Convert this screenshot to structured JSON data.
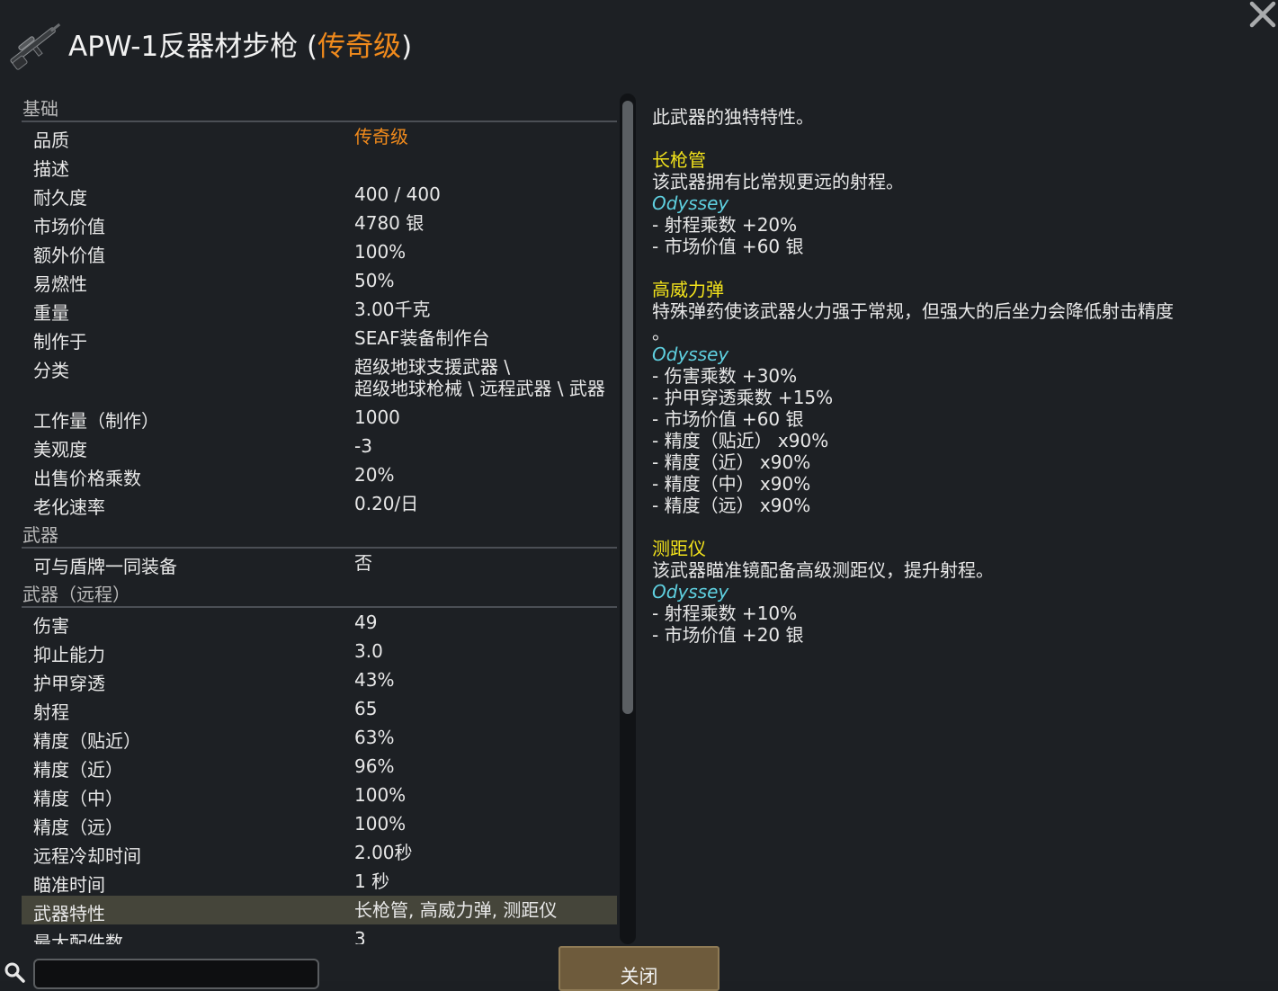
{
  "header": {
    "title_main": "APW-1反器材步枪 (",
    "title_quality": "传奇级",
    "title_close": ")",
    "weapon_icon": "sniper-rifle-icon",
    "close_icon": "close-x-icon"
  },
  "stats": [
    {
      "type": "cat",
      "label": "基础"
    },
    {
      "type": "row",
      "label": "品质",
      "value": "传奇级",
      "orange": true
    },
    {
      "type": "row",
      "label": "描述",
      "value": ""
    },
    {
      "type": "row",
      "label": "耐久度",
      "value": "400 / 400"
    },
    {
      "type": "row",
      "label": "市场价值",
      "value": "4780 银"
    },
    {
      "type": "row",
      "label": "额外价值",
      "value": "100%"
    },
    {
      "type": "row",
      "label": "易燃性",
      "value": "50%"
    },
    {
      "type": "row",
      "label": "重量",
      "value": "3.00千克"
    },
    {
      "type": "row",
      "label": "制作于",
      "value": "SEAF装备制作台"
    },
    {
      "type": "row",
      "label": "分类",
      "value": "超级地球支援武器 \\",
      "value2": "超级地球枪械 \\ 远程武器 \\ 武器"
    },
    {
      "type": "row",
      "label": "工作量（制作）",
      "value": "1000"
    },
    {
      "type": "row",
      "label": "美观度",
      "value": "-3"
    },
    {
      "type": "row",
      "label": "出售价格乘数",
      "value": "20%"
    },
    {
      "type": "row",
      "label": "老化速率",
      "value": "0.20/日"
    },
    {
      "type": "cat",
      "label": "武器"
    },
    {
      "type": "row",
      "label": "可与盾牌一同装备",
      "value": "否"
    },
    {
      "type": "cat",
      "label": "武器（远程）"
    },
    {
      "type": "row",
      "label": "伤害",
      "value": "49"
    },
    {
      "type": "row",
      "label": "抑止能力",
      "value": "3.0"
    },
    {
      "type": "row",
      "label": "护甲穿透",
      "value": "43%"
    },
    {
      "type": "row",
      "label": "射程",
      "value": "65"
    },
    {
      "type": "row",
      "label": "精度（贴近）",
      "value": "63%"
    },
    {
      "type": "row",
      "label": "精度（近）",
      "value": "96%"
    },
    {
      "type": "row",
      "label": "精度（中）",
      "value": "100%"
    },
    {
      "type": "row",
      "label": "精度（远）",
      "value": "100%"
    },
    {
      "type": "row",
      "label": "远程冷却时间",
      "value": "2.00秒"
    },
    {
      "type": "row",
      "label": "瞄准时间",
      "value": "1 秒"
    },
    {
      "type": "row",
      "label": "武器特性",
      "value": "长枪管, 高威力弹, 测距仪",
      "highlight": true
    },
    {
      "type": "row",
      "label": "最大配件数",
      "value": "3"
    }
  ],
  "description": {
    "intro": "此武器的独特特性。",
    "traits": [
      {
        "name": "长枪管",
        "desc": [
          "该武器拥有比常规更远的射程。"
        ],
        "source": "Odyssey",
        "mods": [
          "- 射程乘数 +20%",
          "- 市场价值 +60 银"
        ]
      },
      {
        "name": "高威力弹",
        "desc": [
          "特殊弹药使该武器火力强于常规，但强大的后坐力会降低射击精度",
          "。"
        ],
        "source": "Odyssey",
        "mods": [
          "- 伤害乘数 +30%",
          "- 护甲穿透乘数 +15%",
          "- 市场价值 +60 银",
          "- 精度（贴近） x90%",
          "- 精度（近） x90%",
          "- 精度（中） x90%",
          "- 精度（远） x90%"
        ]
      },
      {
        "name": "测距仪",
        "desc": [
          "该武器瞄准镜配备高级测距仪，提升射程。"
        ],
        "source": "Odyssey",
        "mods": [
          "- 射程乘数 +10%",
          "- 市场价值 +20 银"
        ]
      }
    ]
  },
  "bottom": {
    "search_icon": "search-icon",
    "search_value": "",
    "close_label": "关闭"
  },
  "colors": {
    "quality": "#f08a1c",
    "trait_name": "#f2e21b",
    "trait_source": "#5fd0e0",
    "highlight_row": "#45453a",
    "background": "#1d2024"
  }
}
